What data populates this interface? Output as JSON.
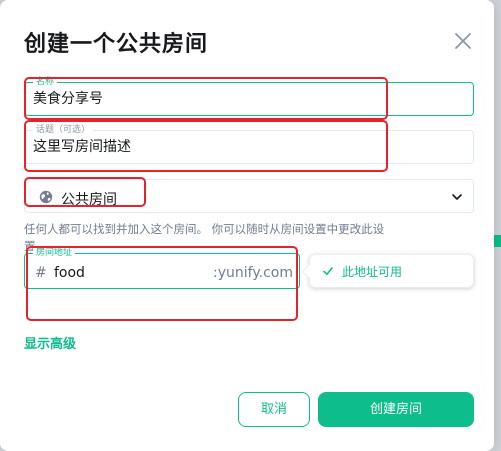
{
  "dialog": {
    "title": "创建一个公共房间",
    "close_icon": "close-icon"
  },
  "name_field": {
    "label": "名称",
    "value": "美食分享号"
  },
  "topic_field": {
    "label": "话题（可选）",
    "value": "这里写房间描述"
  },
  "visibility": {
    "selected": "公共房间",
    "icon": "globe-icon",
    "help_text": "任何人都可以找到并加入这个房间。 你可以随时从房间设置中更改此设置。"
  },
  "address_field": {
    "label": "房间地址",
    "prefix": "#",
    "value": "food",
    "domain": ":yunify.com"
  },
  "address_status": {
    "text": "此地址可用",
    "icon": "check-icon"
  },
  "advanced_link": "显示高级",
  "buttons": {
    "cancel": "取消",
    "create": "创建房间"
  },
  "colors": {
    "accent": "#0dbd8b",
    "annotation": "#e5232d"
  }
}
